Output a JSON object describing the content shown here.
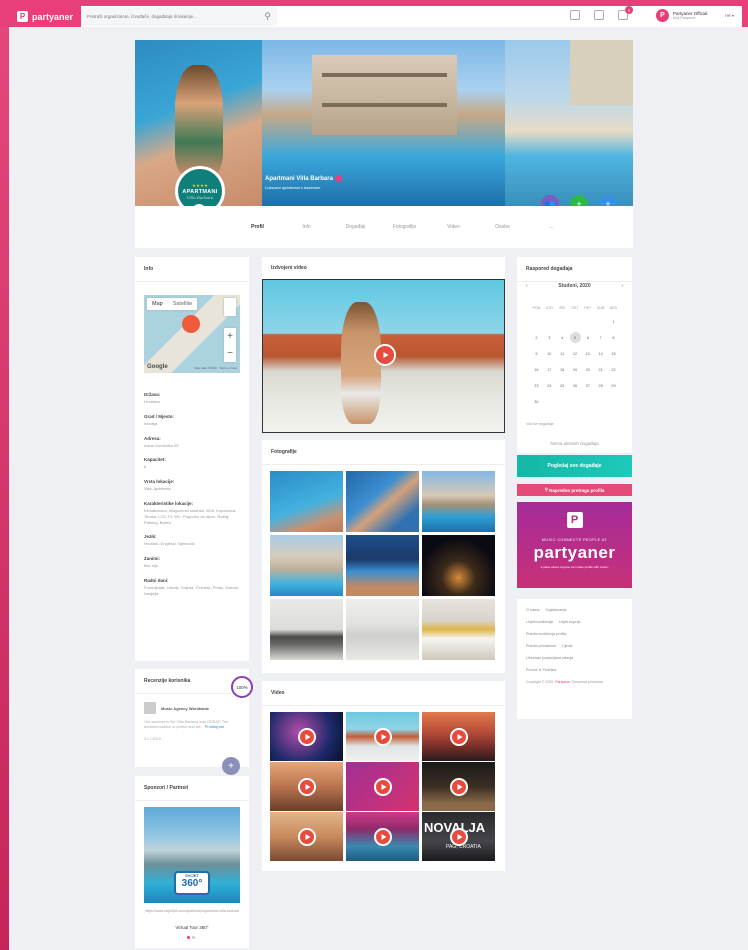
{
  "header": {
    "logo": "partyaner",
    "search_placeholder": "Pretraži organizatore, izvođače, događanja ili lokacije...",
    "notifications_count": "0",
    "user_name": "Partyaner Official",
    "user_sub": "Moji Partyaner",
    "lang": "HR"
  },
  "profile": {
    "name": "Apartmani Villa Barbara",
    "subtitle": "Luksuzni apartmani s bazenom",
    "logo_stars": "★★★★",
    "logo_brand": "APARTMANI",
    "logo_script": "Villa Barbara"
  },
  "tabs": [
    "Profil",
    "Info",
    "Događaji",
    "Fotografije",
    "Video",
    "Osobe",
    "..."
  ],
  "info": {
    "title": "Info",
    "map": {
      "tab_map": "Map",
      "tab_satellite": "Satellite",
      "google": "Google",
      "legal": "Map data ©2020 · Terms of Use"
    },
    "items": [
      {
        "label": "Država:",
        "value": "Hrvatska"
      },
      {
        "label": "Grad / Mjesto:",
        "value": "Novalja"
      },
      {
        "label": "Adresa:",
        "value": "Ivana Gundulića 25"
      },
      {
        "label": "Kapacitet:",
        "value": "8"
      },
      {
        "label": "Vrsta lokacije:",
        "value": "Villa, Apartman"
      },
      {
        "label": "Karakteristike lokacije:",
        "value": "Klimatizirano, Mogućnost ostanka, Wi-fi, Kupaonica, Terasa, LCD TV, WC, Pogodno za djecu, Roštilj, Parking, Bazen"
      },
      {
        "label": "Jezik:",
        "value": "Hrvatski, Engleski, Njemački"
      },
      {
        "label": "Zanimi:",
        "value": "Bez nije"
      },
      {
        "label": "Radni dani:",
        "value": "Ponedjeljak, Utorak, Srijeda, Četvrtak, Petak, Subota, Nedjelja"
      }
    ]
  },
  "reviews": {
    "title": "Recenzije korisnika",
    "percent": "100%",
    "author": "Music Agency Worldwide",
    "text": "Our summer in the Villa Barbara was GREAT! The accommodation is perfect and we...",
    "more": "Pročitaj sve",
    "date": "31.7.2019"
  },
  "sponsors": {
    "title": "Sponzori / Partneri",
    "badge_top": "SVIJET",
    "badge_main": "360°",
    "url": "https://www.svijet360.com/apartmani/apartmani-villa-barbara",
    "name": "Virtual Tour 360°"
  },
  "featured_video": {
    "title": "Izdvojeni video"
  },
  "photos": {
    "title": "Fotografije"
  },
  "videos": {
    "title": "Video",
    "overlay_text": "NOVALJA",
    "overlay_sub": "PAG, CROATIA"
  },
  "calendar": {
    "title": "Raspored događaja",
    "month": "Studeni, 2020",
    "weekdays": [
      "PON",
      "UTO",
      "SRI",
      "ČET",
      "PET",
      "SUB",
      "NED"
    ],
    "days": [
      "",
      "",
      "",
      "",
      "",
      "",
      "1",
      "2",
      "3",
      "4",
      "5",
      "6",
      "7",
      "8",
      "9",
      "10",
      "11",
      "12",
      "13",
      "14",
      "15",
      "16",
      "17",
      "18",
      "19",
      "20",
      "21",
      "22",
      "23",
      "24",
      "25",
      "26",
      "27",
      "28",
      "29",
      "30"
    ],
    "selected_day": "5",
    "link": "Vidi sve događaje",
    "empty": "Nema aktivnih događaja"
  },
  "buttons": {
    "all_events": "Pogledaj sve događaje",
    "advanced_search": "Napredno pretraga profila"
  },
  "banner": {
    "tagline": "MUSIC CONNECTS PEOPLE AT",
    "name": "partyaner",
    "sub": "a place where anyone can make profile with music!"
  },
  "footer": {
    "links": [
      "O nama",
      "Oglašavanje",
      "Uvjeti korištenja",
      "Uvjeti kupnje",
      "Pravila korištenja profila",
      "Pravila privatnosti",
      "Cjenik",
      "Učestalo postavljana pitanja",
      "Pomoć & Podrška"
    ],
    "copyright": "Copyright © 2020.",
    "copyright_brand": "Partyaner",
    "copyright_rest": "Sva prava pridržana"
  },
  "colors": {
    "brand": "#e83e79",
    "teal": "#15b7a7",
    "action_purple": "#7c5cc4",
    "action_green": "#2fb84a",
    "action_blue": "#3b8fe0"
  }
}
